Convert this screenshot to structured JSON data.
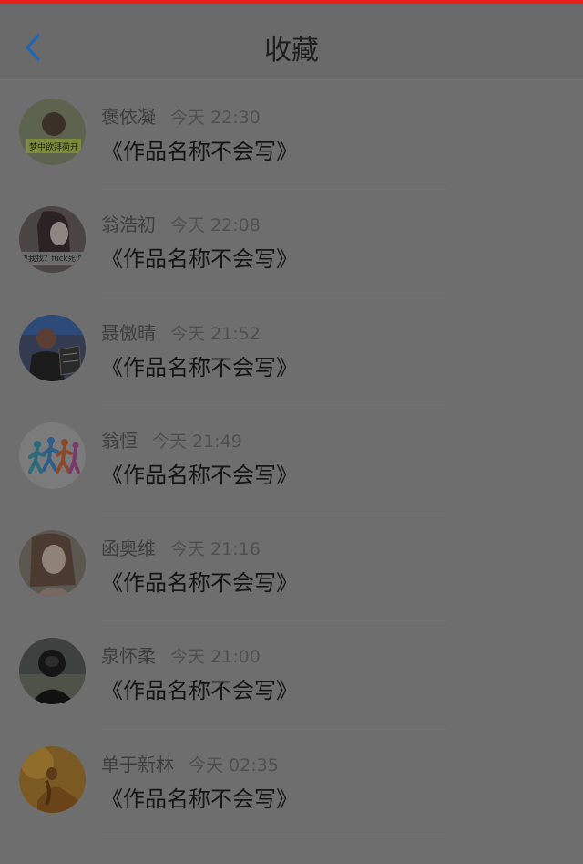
{
  "header": {
    "title": "收藏",
    "back_icon": "chevron-left-icon",
    "accent": "#1f66b3"
  },
  "items": [
    {
      "name": "褒依凝",
      "time": "今天 22:30",
      "work": "《作品名称不会写》",
      "avatar_caption": "梦中欲拜荷开"
    },
    {
      "name": "翁浩初",
      "time": "今天 22:08",
      "work": "《作品名称不会写》",
      "avatar_caption": "要我找？fuck死你"
    },
    {
      "name": "聂傲晴",
      "time": "今天 21:52",
      "work": "《作品名称不会写》"
    },
    {
      "name": "翁恒",
      "time": "今天 21:49",
      "work": "《作品名称不会写》"
    },
    {
      "name": "函奥维",
      "time": "今天 21:16",
      "work": "《作品名称不会写》"
    },
    {
      "name": "泉怀柔",
      "time": "今天 21:00",
      "work": "《作品名称不会写》"
    },
    {
      "name": "单于新林",
      "time": "今天 02:35",
      "work": "《作品名称不会写》"
    }
  ]
}
